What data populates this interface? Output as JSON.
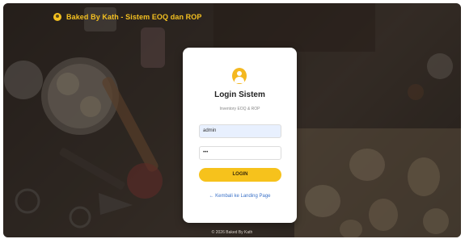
{
  "brand": {
    "title": "Baked By Kath - Sistem EOQ dan ROP",
    "icon": "user-circle-icon",
    "accent_color": "#f4c020"
  },
  "login": {
    "title": "Login Sistem",
    "subtitle": "Inventory EOQ & ROP",
    "username_value": "admin",
    "password_value": "•••",
    "button_label": "LOGIN",
    "back_link": "← Kembali ke Landing Page",
    "avatar_icon": "user-avatar-icon",
    "button_color": "#f6c21c",
    "link_color": "#3b72c8"
  },
  "footer": {
    "text": "© 2026 Baked By Kath"
  }
}
